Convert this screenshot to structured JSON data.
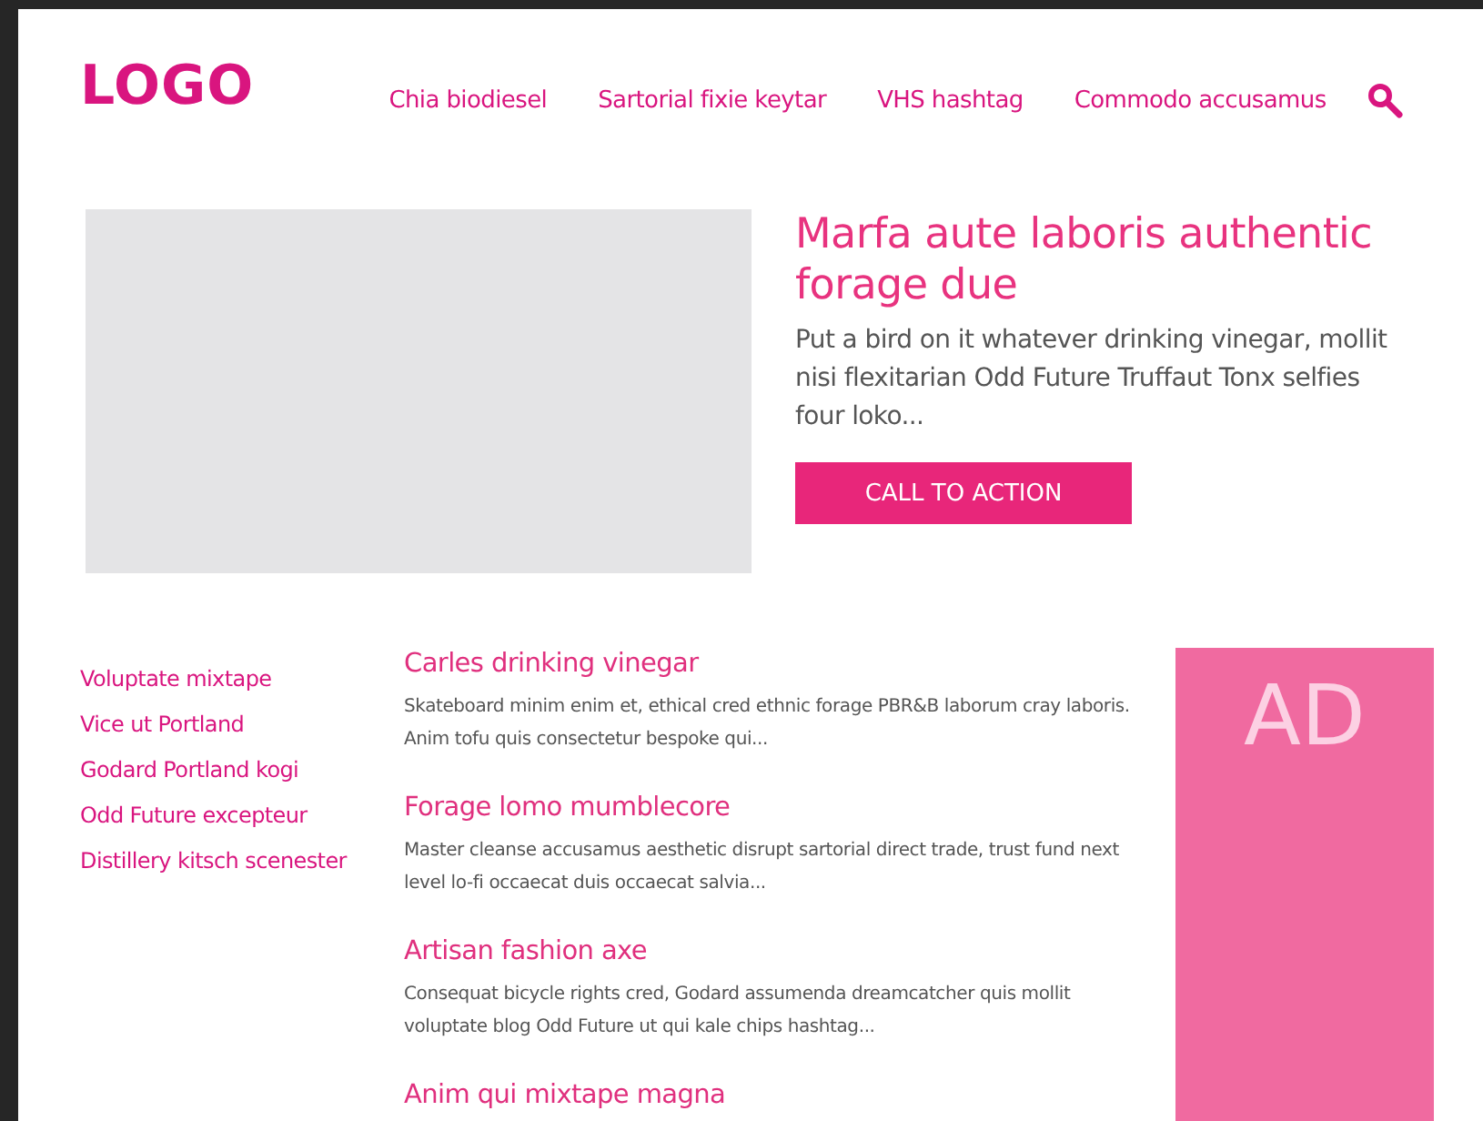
{
  "header": {
    "logo": "LOGO",
    "nav": [
      "Chia biodiesel",
      "Sartorial fixie keytar",
      "VHS hashtag",
      "Commodo accusamus"
    ]
  },
  "hero": {
    "title": "Marfa aute laboris authentic forage due",
    "text": "Put a bird on it whatever drinking vinegar, mollit nisi flexitarian Odd Future Truffaut Tonx selfies four loko...",
    "button": "CALL TO ACTION"
  },
  "sidebar": {
    "links": [
      "Voluptate mixtape",
      "Vice ut Portland",
      "Godard Portland kogi",
      "Odd Future excepteur",
      "Distillery kitsch scenester"
    ]
  },
  "articles": [
    {
      "title": "Carles drinking vinegar",
      "text": "Skateboard minim enim et, ethical cred ethnic forage PBR&B laborum cray laboris. Anim tofu quis consectetur bespoke qui..."
    },
    {
      "title": "Forage lomo mumblecore",
      "text": "Master cleanse accusamus aesthetic disrupt sartorial direct trade, trust fund next level lo-fi occaecat duis occaecat salvia..."
    },
    {
      "title": "Artisan fashion axe",
      "text": "Consequat bicycle rights cred, Godard assumenda dreamcatcher quis mollit voluptate blog Odd Future ut qui kale chips hashtag..."
    },
    {
      "title": "Anim qui mixtape magna"
    }
  ],
  "ad": {
    "label": "AD"
  }
}
